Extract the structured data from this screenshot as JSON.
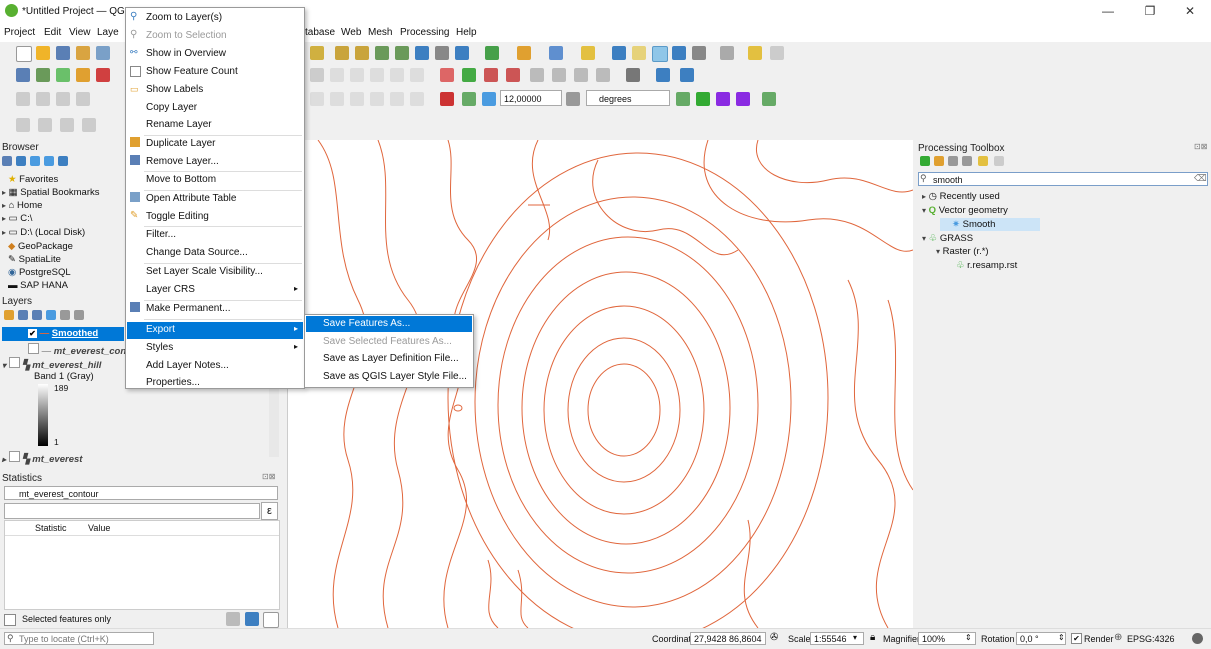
{
  "window": {
    "title": "*Untitled Project — QGIS",
    "minimize": "—",
    "maximize": "❐",
    "close": "✕"
  },
  "menubar": [
    "Project",
    "Edit",
    "View",
    "Laye",
    "tabase",
    "Web",
    "Mesh",
    "Processing",
    "Help"
  ],
  "context_menu": {
    "items": [
      {
        "label": "Zoom to Layer(s)",
        "disabled": false
      },
      {
        "label": "Zoom to Selection",
        "disabled": true
      },
      {
        "label": "Show in Overview",
        "disabled": false
      },
      {
        "label": "Show Feature Count",
        "disabled": false
      },
      {
        "label": "Show Labels",
        "disabled": false
      },
      {
        "label": "Copy Layer",
        "disabled": false
      },
      {
        "label": "Rename Layer",
        "disabled": false
      },
      {
        "label": "Duplicate Layer",
        "disabled": false
      },
      {
        "label": "Remove Layer...",
        "disabled": false
      },
      {
        "label": "Move to Bottom",
        "disabled": false
      },
      {
        "label": "Open Attribute Table",
        "disabled": false
      },
      {
        "label": "Toggle Editing",
        "disabled": false
      },
      {
        "label": "Filter...",
        "disabled": false
      },
      {
        "label": "Change Data Source...",
        "disabled": false
      },
      {
        "label": "Set Layer Scale Visibility...",
        "disabled": false
      },
      {
        "label": "Layer CRS",
        "disabled": false
      },
      {
        "label": "Make Permanent...",
        "disabled": false
      },
      {
        "label": "Export",
        "disabled": false
      },
      {
        "label": "Styles",
        "disabled": false
      },
      {
        "label": "Add Layer Notes...",
        "disabled": false
      },
      {
        "label": "Properties...",
        "disabled": false
      }
    ]
  },
  "export_submenu": [
    {
      "label": "Save Features As...",
      "disabled": false
    },
    {
      "label": "Save Selected Features As...",
      "disabled": true
    },
    {
      "label": "Save as Layer Definition File...",
      "disabled": false
    },
    {
      "label": "Save as QGIS Layer Style File...",
      "disabled": false
    }
  ],
  "toolbar": {
    "angle_value": "12,00000",
    "angle_unit": "degrees"
  },
  "browser": {
    "title": "Browser",
    "items": [
      "Favorites",
      "Spatial Bookmarks",
      "Home",
      "C:\\",
      "D:\\ (Local Disk)",
      "GeoPackage",
      "SpatiaLite",
      "PostgreSQL",
      "SAP HANA"
    ]
  },
  "layers": {
    "title": "Layers",
    "items": [
      "Smoothed",
      "mt_everest_con",
      "mt_everest_hill",
      "Band 1 (Gray)",
      "189",
      "1",
      "mt_everest"
    ]
  },
  "statistics": {
    "title": "Statistics",
    "layer": "mt_everest_contour",
    "col_statistic": "Statistic",
    "col_value": "Value",
    "selected_only": "Selected features only",
    "expr_btn": "ε"
  },
  "processing": {
    "title": "Processing Toolbox",
    "search": "smooth",
    "items": [
      "Recently used",
      "Vector geometry",
      "Smooth",
      "GRASS",
      "Raster (r.*)",
      "r.resamp.rst"
    ]
  },
  "statusbar": {
    "locate_placeholder": "Type to locate (Ctrl+K)",
    "coordinate_label": "Coordinate",
    "coordinate": "27,9428 86,8604",
    "scale_label": "Scale",
    "scale": "1:55546",
    "magnifier_label": "Magnifier",
    "magnifier": "100%",
    "rotation_label": "Rotation",
    "rotation": "0,0 °",
    "render_label": "Render",
    "crs": "EPSG:4326"
  },
  "colors": {
    "accent": "#0078d7",
    "contour": "#e0663c",
    "qgis_green": "#58b031"
  }
}
